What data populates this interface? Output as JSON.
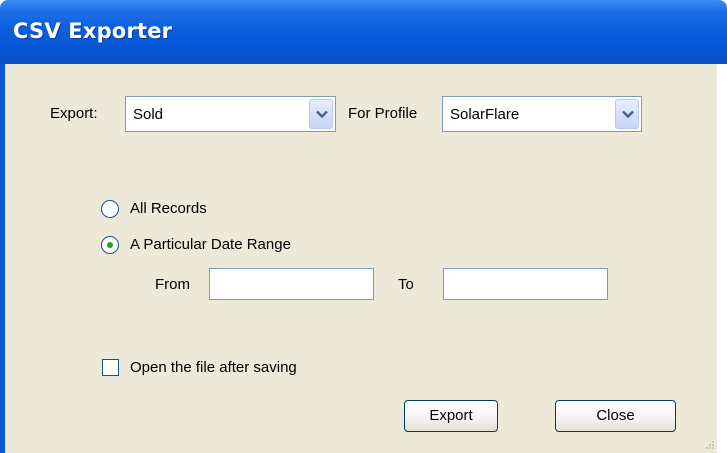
{
  "window": {
    "title": "CSV Exporter"
  },
  "export_row": {
    "export_label": "Export:",
    "export_value": "Sold",
    "profile_label": "For Profile",
    "profile_value": "SolarFlare"
  },
  "range": {
    "all_records_label": "All Records",
    "all_records_selected": false,
    "date_range_label": "A Particular Date Range",
    "date_range_selected": true,
    "from_label": "From",
    "from_value": "",
    "to_label": "To",
    "to_value": ""
  },
  "options": {
    "open_after_label": "Open the file after saving",
    "open_after_checked": false
  },
  "buttons": {
    "export_label": "Export",
    "close_label": "Close"
  },
  "colors": {
    "title_bar": "#0a5fde",
    "client_bg": "#ece9d8",
    "radio_dot": "#21a121"
  }
}
